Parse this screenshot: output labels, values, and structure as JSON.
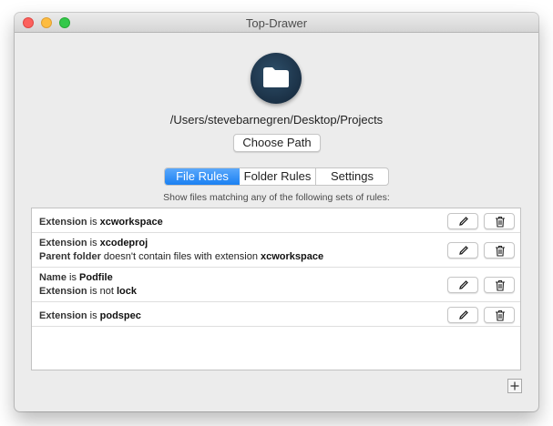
{
  "window": {
    "title": "Top-Drawer"
  },
  "project": {
    "path": "/Users/stevebarnegren/Desktop/Projects",
    "choose_label": "Choose Path"
  },
  "tabs": [
    {
      "label": "File Rules",
      "selected": true
    },
    {
      "label": "Folder Rules",
      "selected": false
    },
    {
      "label": "Settings",
      "selected": false
    }
  ],
  "rules_caption": "Show files matching any of the following sets of rules:",
  "rules": [
    {
      "lines": [
        {
          "k": "Extension",
          "mid": " is ",
          "v": "xcworkspace",
          "rest": "",
          "v2": ""
        }
      ]
    },
    {
      "lines": [
        {
          "k": "Extension",
          "mid": " is ",
          "v": "xcodeproj",
          "rest": "",
          "v2": ""
        },
        {
          "k": "Parent folder",
          "mid": " doesn't contain files with extension ",
          "v": "xcworkspace",
          "rest": "",
          "v2": ""
        }
      ]
    },
    {
      "lines": [
        {
          "k": "Name",
          "mid": " is ",
          "v": "Podfile",
          "rest": "",
          "v2": ""
        },
        {
          "k": "Extension",
          "mid": " is not ",
          "v": "lock",
          "rest": "",
          "v2": ""
        }
      ]
    },
    {
      "lines": [
        {
          "k": "Extension",
          "mid": " is ",
          "v": "podspec",
          "rest": "",
          "v2": ""
        }
      ]
    }
  ],
  "icons": {
    "app": "folder-icon",
    "edit": "pencil-icon",
    "delete": "trash-icon",
    "add": "plus-icon"
  },
  "colors": {
    "accent": "#2a8ef4",
    "app_icon_bg": "#1b3146"
  }
}
